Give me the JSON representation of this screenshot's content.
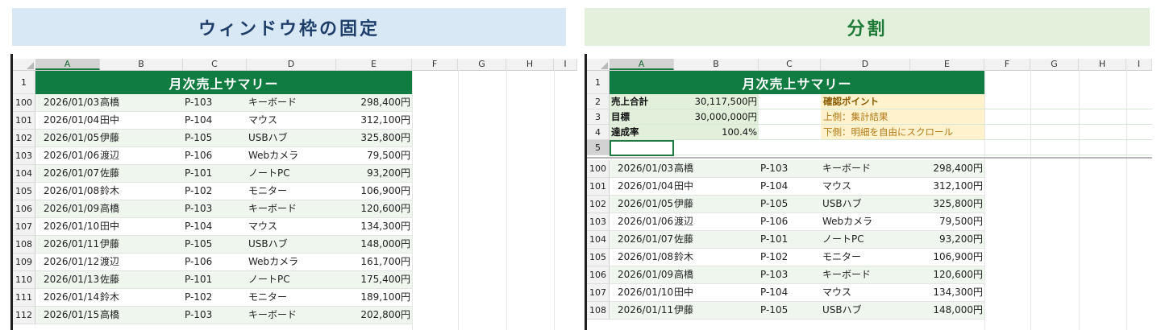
{
  "banners": {
    "freeze": "ウィンドウ枠の固定",
    "split": "分割"
  },
  "columns": [
    "A",
    "B",
    "C",
    "D",
    "E",
    "F",
    "G",
    "H",
    "I"
  ],
  "sheet_title": "月次売上サマリー",
  "summary": {
    "rows": [
      {
        "num": "2",
        "label": "売上合計",
        "value": "30,117,500円"
      },
      {
        "num": "3",
        "label": "目標",
        "value": "30,000,000円"
      },
      {
        "num": "4",
        "label": "達成率",
        "value": "100.4%"
      },
      {
        "num": "5",
        "label": "",
        "value": ""
      }
    ],
    "notes": [
      "確認ポイント",
      "上側：集計結果",
      "下側：明細を自由にスクロール"
    ]
  },
  "freeze_rows": [
    {
      "num": "100",
      "date": "2026/01/03",
      "person": "高橋",
      "code": "P-103",
      "product": "キーボード",
      "amount": "298,400円"
    },
    {
      "num": "101",
      "date": "2026/01/04",
      "person": "田中",
      "code": "P-104",
      "product": "マウス",
      "amount": "312,100円"
    },
    {
      "num": "102",
      "date": "2026/01/05",
      "person": "伊藤",
      "code": "P-105",
      "product": "USBハブ",
      "amount": "325,800円"
    },
    {
      "num": "103",
      "date": "2026/01/06",
      "person": "渡辺",
      "code": "P-106",
      "product": "Webカメラ",
      "amount": "79,500円"
    },
    {
      "num": "104",
      "date": "2026/01/07",
      "person": "佐藤",
      "code": "P-101",
      "product": "ノートPC",
      "amount": "93,200円"
    },
    {
      "num": "105",
      "date": "2026/01/08",
      "person": "鈴木",
      "code": "P-102",
      "product": "モニター",
      "amount": "106,900円"
    },
    {
      "num": "106",
      "date": "2026/01/09",
      "person": "高橋",
      "code": "P-103",
      "product": "キーボード",
      "amount": "120,600円"
    },
    {
      "num": "107",
      "date": "2026/01/10",
      "person": "田中",
      "code": "P-104",
      "product": "マウス",
      "amount": "134,300円"
    },
    {
      "num": "108",
      "date": "2026/01/11",
      "person": "伊藤",
      "code": "P-105",
      "product": "USBハブ",
      "amount": "148,000円"
    },
    {
      "num": "109",
      "date": "2026/01/12",
      "person": "渡辺",
      "code": "P-106",
      "product": "Webカメラ",
      "amount": "161,700円"
    },
    {
      "num": "110",
      "date": "2026/01/13",
      "person": "佐藤",
      "code": "P-101",
      "product": "ノートPC",
      "amount": "175,400円"
    },
    {
      "num": "111",
      "date": "2026/01/14",
      "person": "鈴木",
      "code": "P-102",
      "product": "モニター",
      "amount": "189,100円"
    },
    {
      "num": "112",
      "date": "2026/01/15",
      "person": "高橋",
      "code": "P-103",
      "product": "キーボード",
      "amount": "202,800円"
    }
  ],
  "split_rows": [
    {
      "num": "100",
      "date": "2026/01/03",
      "person": "高橋",
      "code": "P-103",
      "product": "キーボード",
      "amount": "298,400円"
    },
    {
      "num": "101",
      "date": "2026/01/04",
      "person": "田中",
      "code": "P-104",
      "product": "マウス",
      "amount": "312,100円"
    },
    {
      "num": "102",
      "date": "2026/01/05",
      "person": "伊藤",
      "code": "P-105",
      "product": "USBハブ",
      "amount": "325,800円"
    },
    {
      "num": "103",
      "date": "2026/01/06",
      "person": "渡辺",
      "code": "P-106",
      "product": "Webカメラ",
      "amount": "79,500円"
    },
    {
      "num": "104",
      "date": "2026/01/07",
      "person": "佐藤",
      "code": "P-101",
      "product": "ノートPC",
      "amount": "93,200円"
    },
    {
      "num": "105",
      "date": "2026/01/08",
      "person": "鈴木",
      "code": "P-102",
      "product": "モニター",
      "amount": "106,900円"
    },
    {
      "num": "106",
      "date": "2026/01/09",
      "person": "高橋",
      "code": "P-103",
      "product": "キーボード",
      "amount": "120,600円"
    },
    {
      "num": "107",
      "date": "2026/01/10",
      "person": "田中",
      "code": "P-104",
      "product": "マウス",
      "amount": "134,300円"
    },
    {
      "num": "108",
      "date": "2026/01/11",
      "person": "伊藤",
      "code": "P-105",
      "product": "USBハブ",
      "amount": "148,000円"
    }
  ],
  "title_row_num": "1"
}
